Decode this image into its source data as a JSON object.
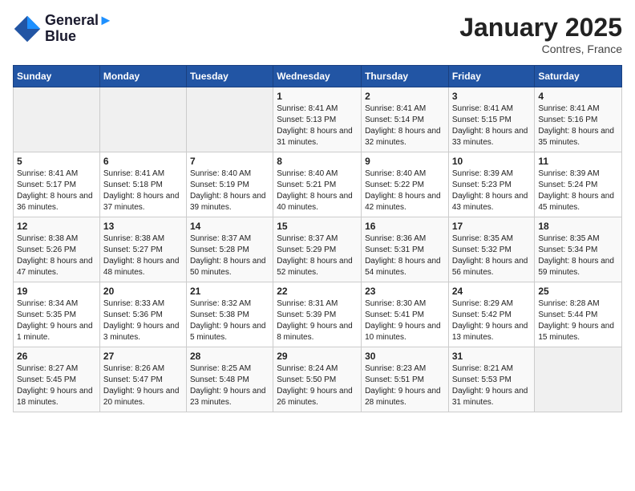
{
  "header": {
    "logo_line1": "General",
    "logo_line2": "Blue",
    "month_title": "January 2025",
    "location": "Contres, France"
  },
  "days_of_week": [
    "Sunday",
    "Monday",
    "Tuesday",
    "Wednesday",
    "Thursday",
    "Friday",
    "Saturday"
  ],
  "weeks": [
    {
      "cells": [
        {
          "day": null,
          "content": null
        },
        {
          "day": null,
          "content": null
        },
        {
          "day": null,
          "content": null
        },
        {
          "day": "1",
          "content": "Sunrise: 8:41 AM\nSunset: 5:13 PM\nDaylight: 8 hours\nand 31 minutes."
        },
        {
          "day": "2",
          "content": "Sunrise: 8:41 AM\nSunset: 5:14 PM\nDaylight: 8 hours\nand 32 minutes."
        },
        {
          "day": "3",
          "content": "Sunrise: 8:41 AM\nSunset: 5:15 PM\nDaylight: 8 hours\nand 33 minutes."
        },
        {
          "day": "4",
          "content": "Sunrise: 8:41 AM\nSunset: 5:16 PM\nDaylight: 8 hours\nand 35 minutes."
        }
      ]
    },
    {
      "cells": [
        {
          "day": "5",
          "content": "Sunrise: 8:41 AM\nSunset: 5:17 PM\nDaylight: 8 hours\nand 36 minutes."
        },
        {
          "day": "6",
          "content": "Sunrise: 8:41 AM\nSunset: 5:18 PM\nDaylight: 8 hours\nand 37 minutes."
        },
        {
          "day": "7",
          "content": "Sunrise: 8:40 AM\nSunset: 5:19 PM\nDaylight: 8 hours\nand 39 minutes."
        },
        {
          "day": "8",
          "content": "Sunrise: 8:40 AM\nSunset: 5:21 PM\nDaylight: 8 hours\nand 40 minutes."
        },
        {
          "day": "9",
          "content": "Sunrise: 8:40 AM\nSunset: 5:22 PM\nDaylight: 8 hours\nand 42 minutes."
        },
        {
          "day": "10",
          "content": "Sunrise: 8:39 AM\nSunset: 5:23 PM\nDaylight: 8 hours\nand 43 minutes."
        },
        {
          "day": "11",
          "content": "Sunrise: 8:39 AM\nSunset: 5:24 PM\nDaylight: 8 hours\nand 45 minutes."
        }
      ]
    },
    {
      "cells": [
        {
          "day": "12",
          "content": "Sunrise: 8:38 AM\nSunset: 5:26 PM\nDaylight: 8 hours\nand 47 minutes."
        },
        {
          "day": "13",
          "content": "Sunrise: 8:38 AM\nSunset: 5:27 PM\nDaylight: 8 hours\nand 48 minutes."
        },
        {
          "day": "14",
          "content": "Sunrise: 8:37 AM\nSunset: 5:28 PM\nDaylight: 8 hours\nand 50 minutes."
        },
        {
          "day": "15",
          "content": "Sunrise: 8:37 AM\nSunset: 5:29 PM\nDaylight: 8 hours\nand 52 minutes."
        },
        {
          "day": "16",
          "content": "Sunrise: 8:36 AM\nSunset: 5:31 PM\nDaylight: 8 hours\nand 54 minutes."
        },
        {
          "day": "17",
          "content": "Sunrise: 8:35 AM\nSunset: 5:32 PM\nDaylight: 8 hours\nand 56 minutes."
        },
        {
          "day": "18",
          "content": "Sunrise: 8:35 AM\nSunset: 5:34 PM\nDaylight: 8 hours\nand 59 minutes."
        }
      ]
    },
    {
      "cells": [
        {
          "day": "19",
          "content": "Sunrise: 8:34 AM\nSunset: 5:35 PM\nDaylight: 9 hours\nand 1 minute."
        },
        {
          "day": "20",
          "content": "Sunrise: 8:33 AM\nSunset: 5:36 PM\nDaylight: 9 hours\nand 3 minutes."
        },
        {
          "day": "21",
          "content": "Sunrise: 8:32 AM\nSunset: 5:38 PM\nDaylight: 9 hours\nand 5 minutes."
        },
        {
          "day": "22",
          "content": "Sunrise: 8:31 AM\nSunset: 5:39 PM\nDaylight: 9 hours\nand 8 minutes."
        },
        {
          "day": "23",
          "content": "Sunrise: 8:30 AM\nSunset: 5:41 PM\nDaylight: 9 hours\nand 10 minutes."
        },
        {
          "day": "24",
          "content": "Sunrise: 8:29 AM\nSunset: 5:42 PM\nDaylight: 9 hours\nand 13 minutes."
        },
        {
          "day": "25",
          "content": "Sunrise: 8:28 AM\nSunset: 5:44 PM\nDaylight: 9 hours\nand 15 minutes."
        }
      ]
    },
    {
      "cells": [
        {
          "day": "26",
          "content": "Sunrise: 8:27 AM\nSunset: 5:45 PM\nDaylight: 9 hours\nand 18 minutes."
        },
        {
          "day": "27",
          "content": "Sunrise: 8:26 AM\nSunset: 5:47 PM\nDaylight: 9 hours\nand 20 minutes."
        },
        {
          "day": "28",
          "content": "Sunrise: 8:25 AM\nSunset: 5:48 PM\nDaylight: 9 hours\nand 23 minutes."
        },
        {
          "day": "29",
          "content": "Sunrise: 8:24 AM\nSunset: 5:50 PM\nDaylight: 9 hours\nand 26 minutes."
        },
        {
          "day": "30",
          "content": "Sunrise: 8:23 AM\nSunset: 5:51 PM\nDaylight: 9 hours\nand 28 minutes."
        },
        {
          "day": "31",
          "content": "Sunrise: 8:21 AM\nSunset: 5:53 PM\nDaylight: 9 hours\nand 31 minutes."
        },
        {
          "day": null,
          "content": null
        }
      ]
    }
  ]
}
